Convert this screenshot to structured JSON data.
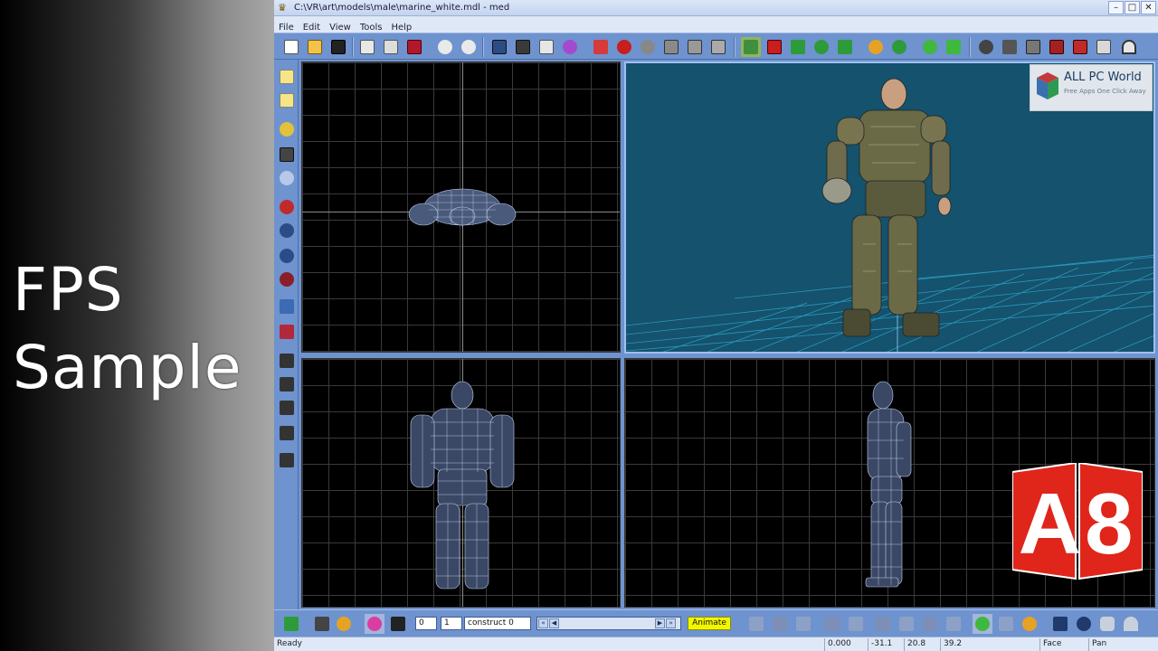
{
  "promo": {
    "line1": "FPS",
    "line2": "Sample"
  },
  "window": {
    "title": "C:\\VR\\art\\models\\male\\marine_white.mdl - med"
  },
  "menu": [
    "File",
    "Edit",
    "View",
    "Tools",
    "Help"
  ],
  "watermark": {
    "title": "ALL PC World",
    "subtitle": "Free Apps One Click Away"
  },
  "badge": {
    "text": "A8"
  },
  "timeline": {
    "frame_start": "0",
    "frame_end": "1",
    "frame_name": "construct 0",
    "animate_label": "Animate"
  },
  "status": {
    "ready": "Ready",
    "cells": [
      "0.000",
      "-31.1",
      "20.8",
      "39.2",
      "Face",
      "Pan"
    ]
  },
  "colors": {
    "ui_blue": "#6e93cf",
    "persp_bg": "#14526d",
    "animate": "#f2f700",
    "badge_red": "#e0251b"
  }
}
